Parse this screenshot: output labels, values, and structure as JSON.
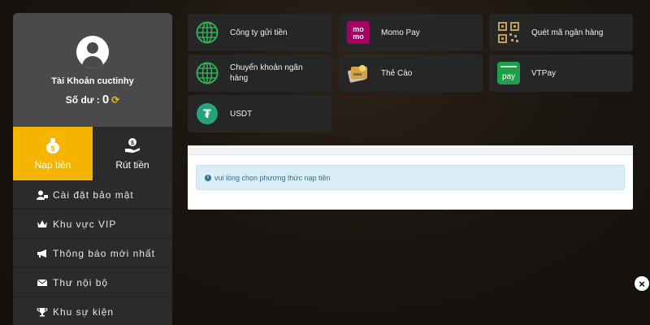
{
  "profile": {
    "account_label": "Tài Khoản cuctinhy",
    "balance_label": "Số dư :",
    "balance_value": "0"
  },
  "tabs": {
    "deposit": "Nạp tiền",
    "withdraw": "Rút tiền"
  },
  "menu": [
    {
      "label": "Cài đặt bảo mật",
      "icon": "user-lock-icon"
    },
    {
      "label": "Khu vực VIP",
      "icon": "vip-crown-icon"
    },
    {
      "label": "Thông báo mới nhất",
      "icon": "megaphone-icon"
    },
    {
      "label": "Thư nội bộ",
      "icon": "envelope-icon"
    },
    {
      "label": "Khu sự kiện",
      "icon": "trophy-icon"
    }
  ],
  "payment_methods": [
    {
      "label": "Công ty gửi tiền",
      "icon": "globe-icon"
    },
    {
      "label": "Momo Pay",
      "icon": "momo-icon"
    },
    {
      "label": "Quét mã ngân hàng",
      "icon": "qr-code-icon"
    },
    {
      "label": "Chuyển khoản ngân hàng",
      "icon": "globe-icon"
    },
    {
      "label": "Thẻ Cào",
      "icon": "scratch-card-icon"
    },
    {
      "label": "VTPay",
      "icon": "vtpay-icon"
    },
    {
      "label": "USDT",
      "icon": "tether-icon"
    }
  ],
  "icon_text": {
    "momo_top": "mo",
    "momo_bottom": "mo",
    "vtpay": "pay",
    "tether": "₮",
    "info": "i",
    "close": "×"
  },
  "notice": "vui lòng chọn phương thức nạp tiền",
  "colors": {
    "accent": "#f5b400",
    "globe": "#2fae5a",
    "momo": "#a50064",
    "vtpay": "#1ea04a",
    "tether": "#26a17b",
    "notice_bg": "#d9edf7",
    "notice_text": "#31708f"
  }
}
